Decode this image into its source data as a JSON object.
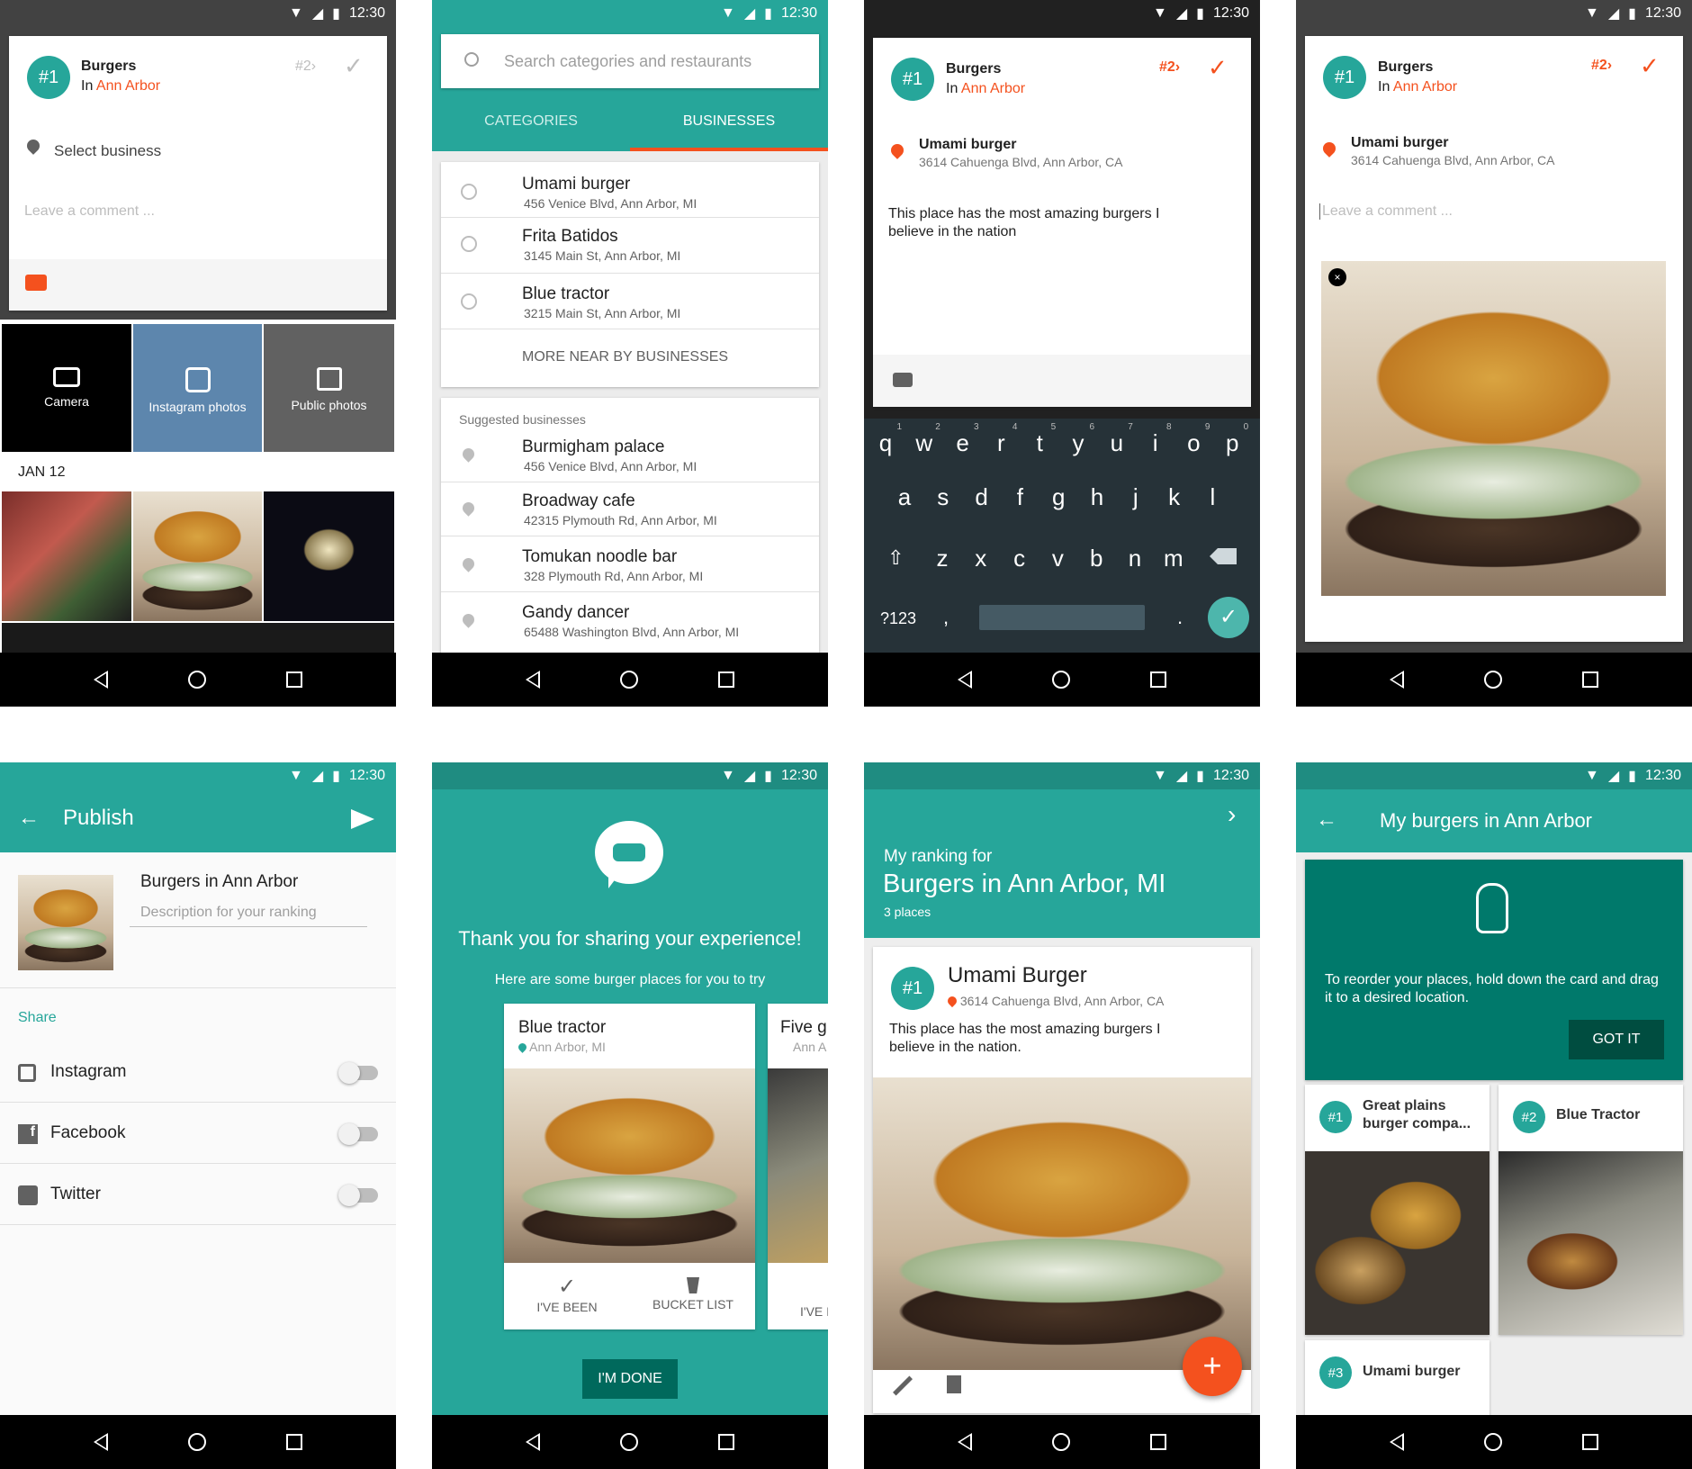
{
  "status": {
    "time": "12:30"
  },
  "s1": {
    "rank": "#1",
    "title": "Burgers",
    "in_prefix": "In",
    "city": "Ann Arbor",
    "next_rank": "#2",
    "select_business": "Select business",
    "comment_placeholder": "Leave a comment ...",
    "sources": [
      {
        "label": "Camera"
      },
      {
        "label": "Instagram photos"
      },
      {
        "label": "Public photos"
      }
    ],
    "date": "JAN 12"
  },
  "s2": {
    "search_placeholder": "Search categories and restaurants",
    "tabs": [
      "CATEGORIES",
      "BUSINESSES"
    ],
    "nearby": [
      {
        "name": "Umami burger",
        "addr": "456 Venice Blvd, Ann Arbor, MI"
      },
      {
        "name": "Frita Batidos",
        "addr": "3145 Main St, Ann Arbor, MI"
      },
      {
        "name": "Blue tractor",
        "addr": "3215 Main St, Ann Arbor, MI"
      }
    ],
    "more": "MORE NEAR BY BUSINESSES",
    "suggested_header": "Suggested businesses",
    "suggested": [
      {
        "name": "Burmigham palace",
        "addr": "456 Venice Blvd, Ann Arbor, MI"
      },
      {
        "name": "Broadway cafe",
        "addr": "42315 Plymouth Rd, Ann Arbor, MI"
      },
      {
        "name": "Tomukan noodle bar",
        "addr": "328 Plymouth Rd, Ann Arbor, MI"
      },
      {
        "name": "Gandy dancer",
        "addr": "65488 Washington Blvd, Ann Arbor, MI"
      }
    ]
  },
  "s3": {
    "rank": "#1",
    "title": "Burgers",
    "in_prefix": "In",
    "city": "Ann Arbor",
    "next_rank": "#2",
    "business": "Umami burger",
    "address": "3614 Cahuenga Blvd, Ann Arbor, CA",
    "comment": "This place has the most amazing burgers I believe in the nation",
    "kb_row1": [
      "q",
      "w",
      "e",
      "r",
      "t",
      "y",
      "u",
      "i",
      "o",
      "p"
    ],
    "kb_row1_num": [
      "1",
      "2",
      "3",
      "4",
      "5",
      "6",
      "7",
      "8",
      "9",
      "0"
    ],
    "kb_row2": [
      "a",
      "s",
      "d",
      "f",
      "g",
      "h",
      "j",
      "k",
      "l"
    ],
    "kb_row3": [
      "z",
      "x",
      "c",
      "v",
      "b",
      "n",
      "m"
    ],
    "kb_sym": "?123",
    "kb_comma": ",",
    "kb_dot": "."
  },
  "s4": {
    "rank": "#1",
    "title": "Burgers",
    "in_prefix": "In",
    "city": "Ann Arbor",
    "next_rank": "#2",
    "business": "Umami burger",
    "address": "3614 Cahuenga Blvd, Ann Arbor, CA",
    "comment_placeholder": "Leave a comment ..."
  },
  "s5": {
    "title": "Publish",
    "ranking_title": "Burgers in Ann Arbor",
    "desc_placeholder": "Description for your ranking",
    "share": "Share",
    "networks": [
      {
        "name": "Instagram"
      },
      {
        "name": "Facebook"
      },
      {
        "name": "Twitter"
      }
    ]
  },
  "s6": {
    "thanks": "Thank you for sharing your experience!",
    "sub": "Here are some burger places for you to try",
    "card1": {
      "name": "Blue tractor",
      "loc": "Ann Arbor, MI",
      "been": "I'VE BEEN",
      "bucket": "BUCKET LIST"
    },
    "card2": {
      "name": "Five g",
      "loc": "Ann A",
      "been": "I'VE I"
    },
    "done": "I'M DONE"
  },
  "s7": {
    "label": "My ranking for",
    "title": "Burgers in Ann Arbor, MI",
    "count": "3 places",
    "rank": "#1",
    "name": "Umami Burger",
    "address": "3614 Cahuenga Blvd, Ann Arbor, CA",
    "comment": "This place has the most amazing burgers I believe in the nation.",
    "fab": "+"
  },
  "s8": {
    "title": "My burgers in Ann Arbor",
    "hint": "To reorder your places, hold down the card and drag it to a desired location.",
    "got_it": "GOT IT",
    "places": [
      {
        "rank": "#1",
        "name": "Great plains burger compa..."
      },
      {
        "rank": "#2",
        "name": "Blue Tractor"
      },
      {
        "rank": "#3",
        "name": "Umami burger"
      }
    ]
  }
}
